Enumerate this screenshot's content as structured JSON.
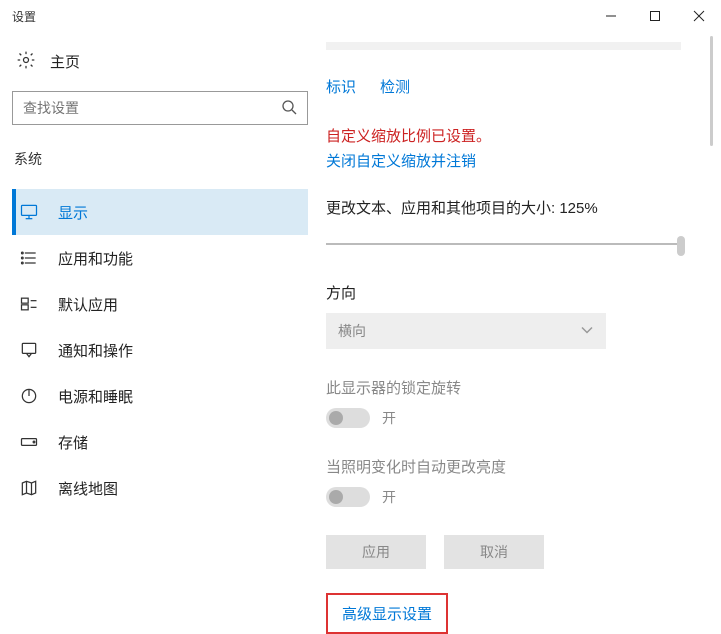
{
  "window": {
    "title": "设置"
  },
  "sidebar": {
    "home": "主页",
    "search_placeholder": "查找设置",
    "section": "系统",
    "items": [
      {
        "label": "显示",
        "selected": true
      },
      {
        "label": "应用和功能"
      },
      {
        "label": "默认应用"
      },
      {
        "label": "通知和操作"
      },
      {
        "label": "电源和睡眠"
      },
      {
        "label": "存储"
      },
      {
        "label": "离线地图"
      }
    ]
  },
  "content": {
    "links": {
      "identify": "标识",
      "detect": "检测"
    },
    "custom_scale_warning": "自定义缩放比例已设置。",
    "turn_off_custom_scale": "关闭自定义缩放并注销",
    "scale_text": "更改文本、应用和其他项目的大小: 125%",
    "orientation": {
      "label": "方向",
      "value": "横向"
    },
    "rotation_lock": {
      "label": "此显示器的锁定旋转",
      "status": "开"
    },
    "auto_brightness": {
      "label": "当照明变化时自动更改亮度",
      "status": "开"
    },
    "buttons": {
      "apply": "应用",
      "cancel": "取消"
    },
    "advanced": "高级显示设置"
  }
}
